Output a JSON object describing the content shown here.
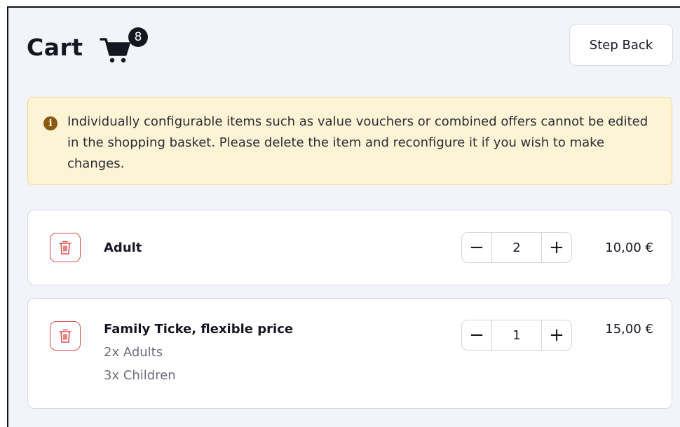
{
  "header": {
    "title": "Cart",
    "cart_icon": "shopping-cart-icon",
    "cart_count": "8",
    "step_back_label": "Step Back"
  },
  "notice": {
    "icon": "info-icon",
    "text": "Individually configurable items such as value vouchers or combined offers cannot be edited in the shopping basket. Please delete the item and reconfigure it if you wish to make changes.",
    "background_color": "#fdf3d5",
    "icon_color": "#8a5a14"
  },
  "items": [
    {
      "name": "Adult",
      "details": [],
      "quantity": "2",
      "price": "10,00 €"
    },
    {
      "name": "Family Ticke, flexible price",
      "details": [
        "2x Adults",
        "3x Children"
      ],
      "quantity": "1",
      "price": "15,00 €"
    }
  ],
  "controls": {
    "minus_symbol": "−",
    "plus_symbol": "+",
    "delete_icon": "trash-icon"
  },
  "colors": {
    "accent_delete": "#d9514e",
    "page_background": "#f3f4f9",
    "text_primary": "#161622"
  }
}
